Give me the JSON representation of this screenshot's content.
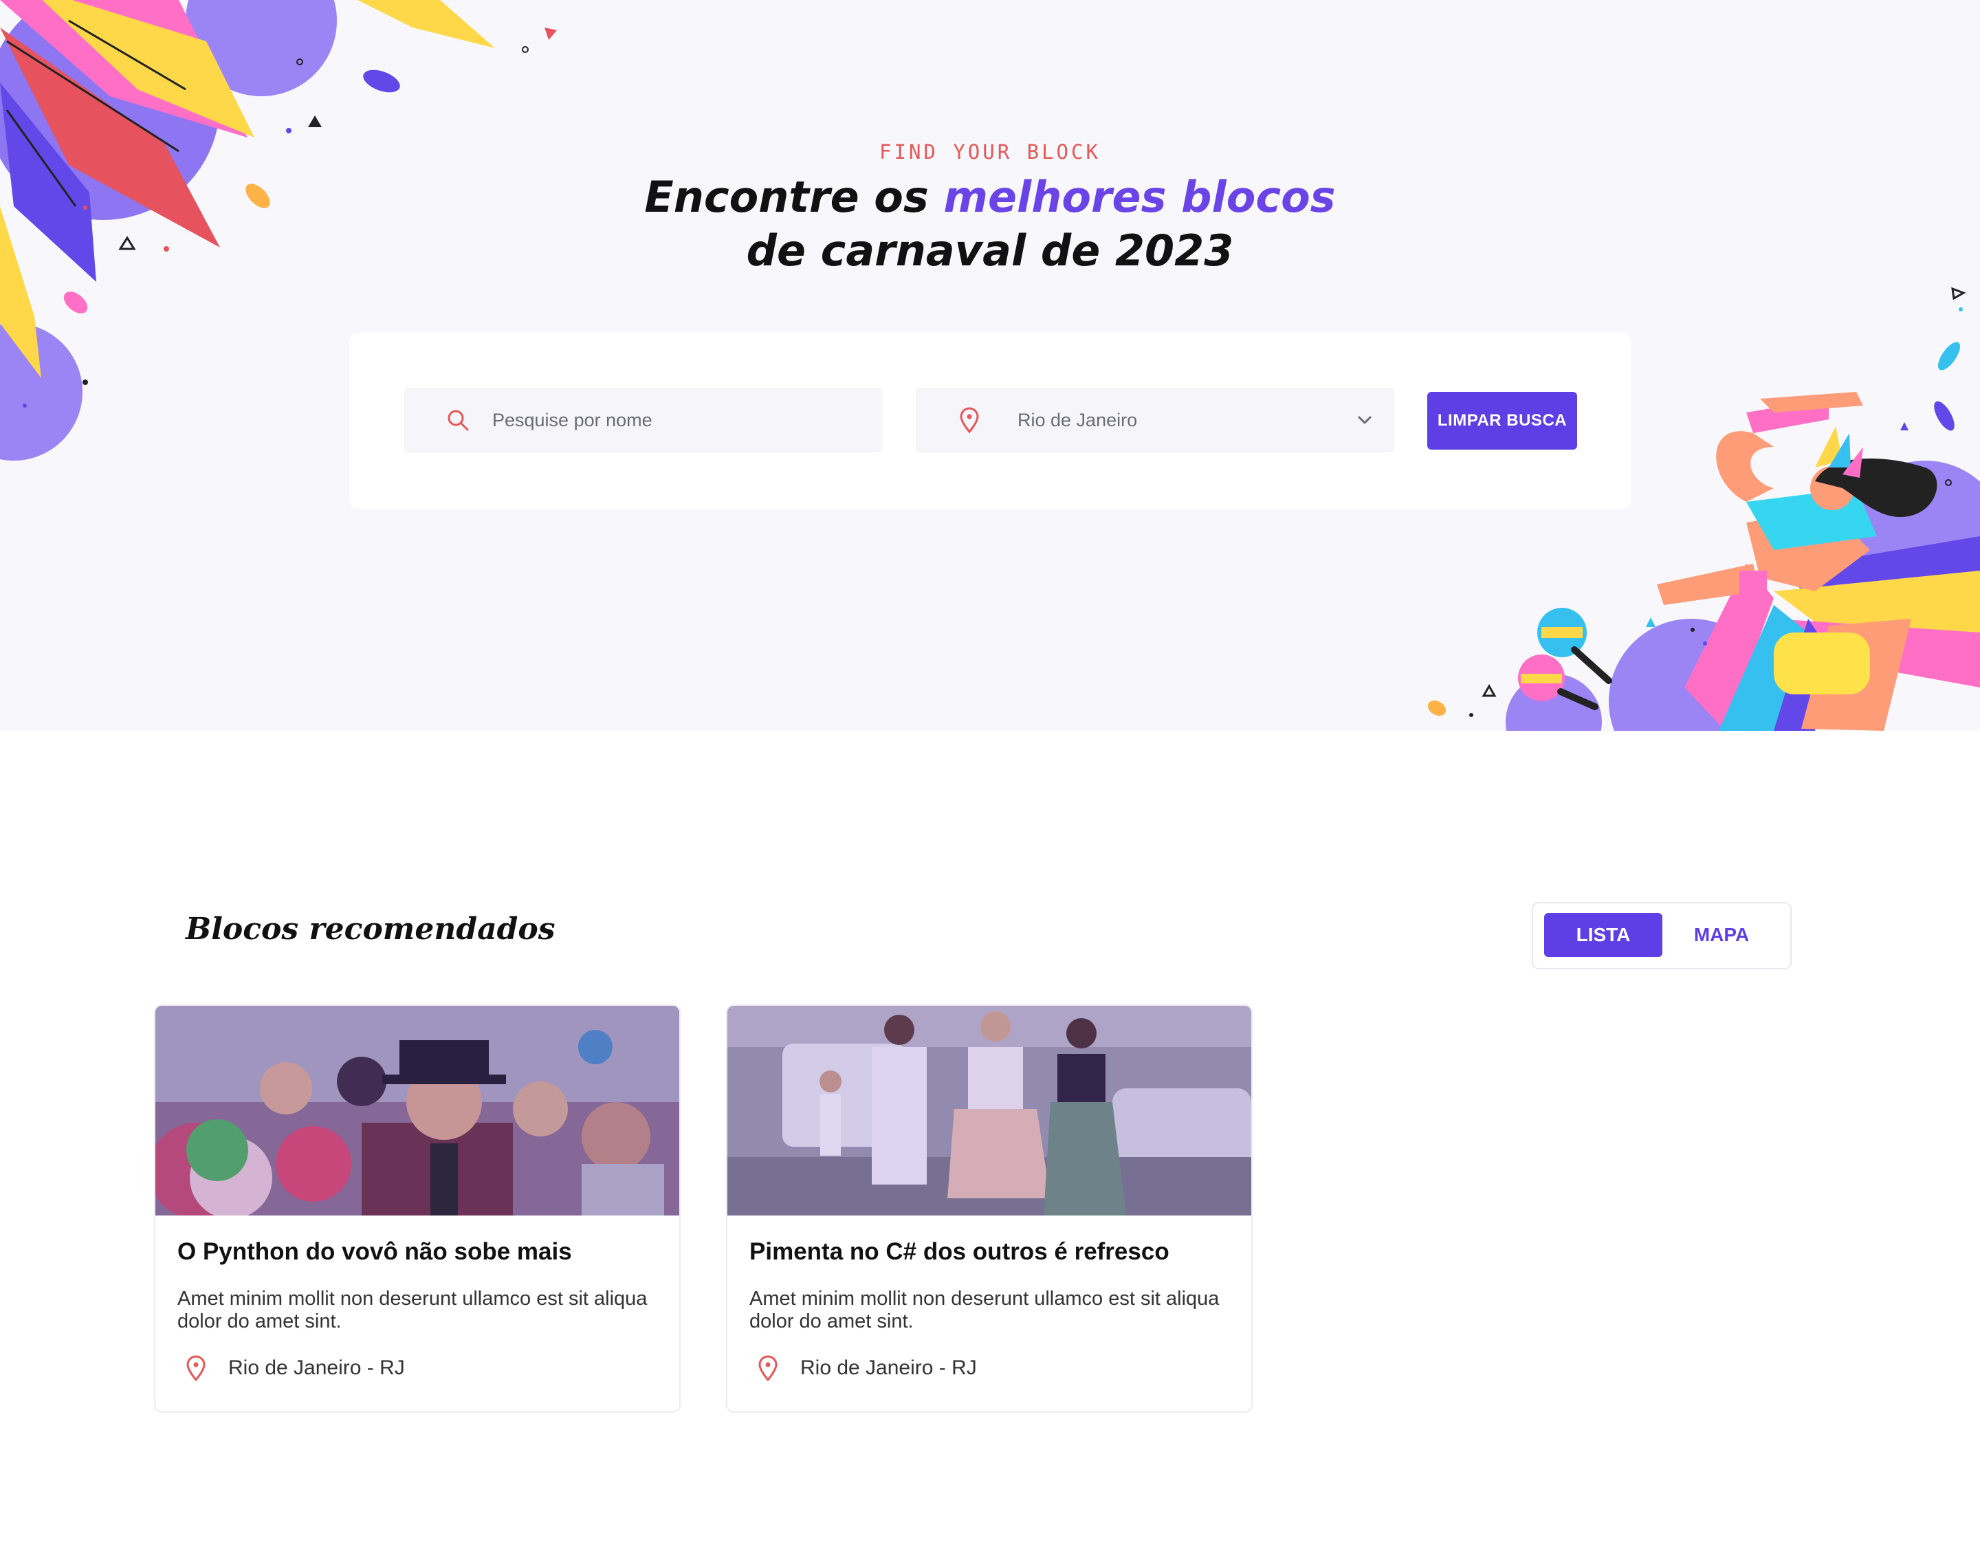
{
  "hero": {
    "eyebrow": "FIND YOUR BLOCK",
    "title_part1": "Encontre os ",
    "title_accent": "melhores blocos",
    "title_line2": "de carnaval de 2023"
  },
  "search": {
    "name_placeholder": "Pesquise por nome",
    "city_value": "Rio de Janeiro",
    "clear_label": "LIMPAR BUSCA",
    "search_icon": "search-icon",
    "pin_icon": "map-pin-icon",
    "chevron_icon": "chevron-down-icon"
  },
  "recommended": {
    "title": "Blocos recomendados",
    "view_toggle": [
      {
        "label": "LISTA",
        "active": true
      },
      {
        "label": "MAPA",
        "active": false
      }
    ],
    "cards": [
      {
        "title": "O Pynthon do vovô não sobe mais",
        "description": "Amet minim mollit non deserunt ullamco est sit aliqua dolor do amet sint.",
        "location": "Rio de Janeiro - RJ"
      },
      {
        "title": "Pimenta no C# dos outros é refresco",
        "description": "Amet minim mollit non deserunt ullamco est sit aliqua dolor do amet sint.",
        "location": "Rio de Janeiro - RJ"
      }
    ]
  },
  "colors": {
    "accent": "#5e3fe6",
    "accent_text": "#6a44e6",
    "eyebrow": "#e45858",
    "hero_bg": "#f8f8fc"
  }
}
